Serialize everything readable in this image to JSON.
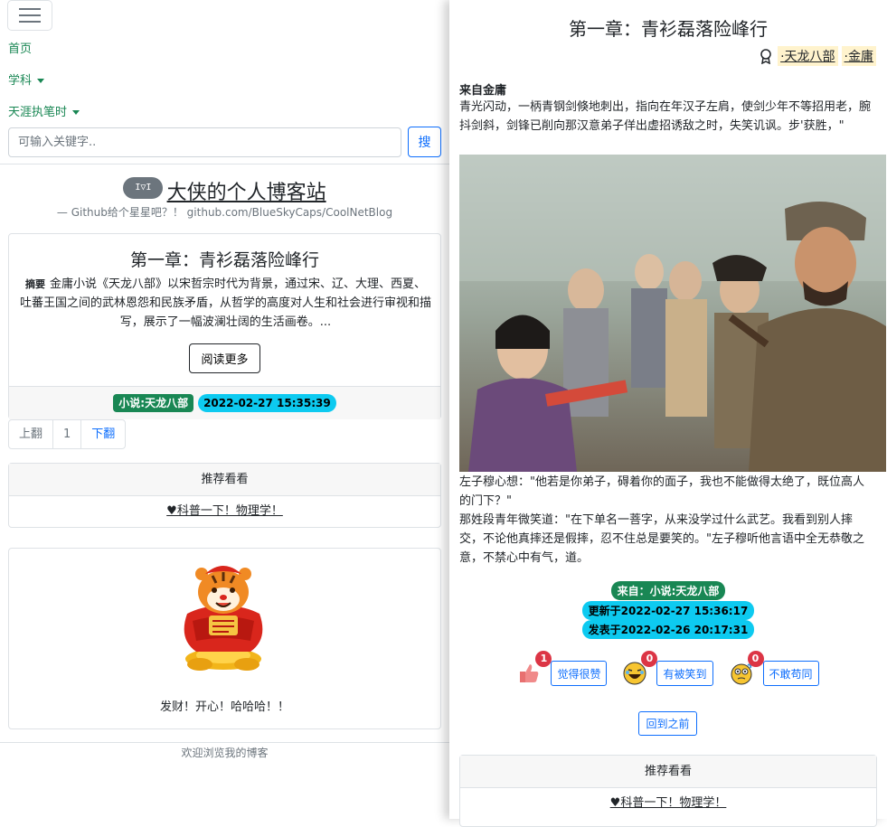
{
  "left": {
    "nav": {
      "home": "首页",
      "subjects": "学科",
      "notes": "天涯执笔时"
    },
    "search": {
      "placeholder": "可输入关键字..",
      "button": "搜"
    },
    "site": {
      "logo_text": "I▽I",
      "title": "大侠的个人博客站",
      "subtitle": "— Github给个星星吧？！ github.com/BlueSkyCaps/CoolNetBlog"
    },
    "post": {
      "title": "第一章：青衫磊落险峰行",
      "abstract_label": "摘要",
      "abstract": "金庸小说《天龙八部》以宋哲宗时代为背景，通过宋、辽、大理、西夏、吐蕃王国之间的武林恩怨和民族矛盾，从哲学的高度对人生和社会进行审视和描写，展示了一幅波澜壮阔的生活画卷。...",
      "read_more": "阅读更多",
      "category": "小说:天龙八部",
      "date": "2022-02-27 15:35:39"
    },
    "pagination": {
      "prev": "上翻",
      "page": "1",
      "next": "下翻"
    },
    "recommend": {
      "header": "推荐看看",
      "link": "♥科普一下！物理学！"
    },
    "widget": {
      "caption": "发财！开心！哈哈哈！！",
      "image": "tiger-mascot"
    },
    "footer": "欢迎浏览我的博客"
  },
  "right": {
    "title": "第一章：青衫磊落险峰行",
    "tags": [
      "·天龙八部",
      "·金庸"
    ],
    "from_label": "来自金庸",
    "para1": "青光闪动，一柄青钢剑倏地刺出，指向在年汉子左肩，使剑少年不等招用老，腕抖剑斜，剑锋已削向那汉意弟子佯出虚招诱敌之时，失笑讥讽。步'获胜，\"",
    "para2": "左子穆心想：\"他若是你弟子，碍着你的面子，我也不能做得太绝了，既位高人的门下？\"",
    "para3": "那姓段青年微笑道：\"在下单名一菩字，从来没学过什么武艺。我看到别人摔交，不论他真摔还是假摔，忍不住总是要笑的。\"左子穆听他言语中全无恭敬之意，不禁心中有气，道。",
    "photo": "drama-still",
    "source": "来自：小说:天龙八部",
    "updated": "更新于2022-02-27 15:36:17",
    "published": "发表于2022-02-26 20:17:31",
    "reactions": [
      {
        "icon": "thumbs-up-icon",
        "count": "1",
        "label": "觉得很赞"
      },
      {
        "icon": "laughing-emoji-icon",
        "count": "0",
        "label": "有被笑到"
      },
      {
        "icon": "confused-emoji-icon",
        "count": "0",
        "label": "不敢苟同"
      }
    ],
    "back": "回到之前",
    "recommend": {
      "header": "推荐看看",
      "link": "♥科普一下！物理学！"
    }
  },
  "colors": {
    "nav_green": "#198754",
    "primary": "#0d6efd",
    "badge_cyan": "#0dcaf0",
    "danger": "#dc3545",
    "tag_bg": "#fff3cd"
  }
}
